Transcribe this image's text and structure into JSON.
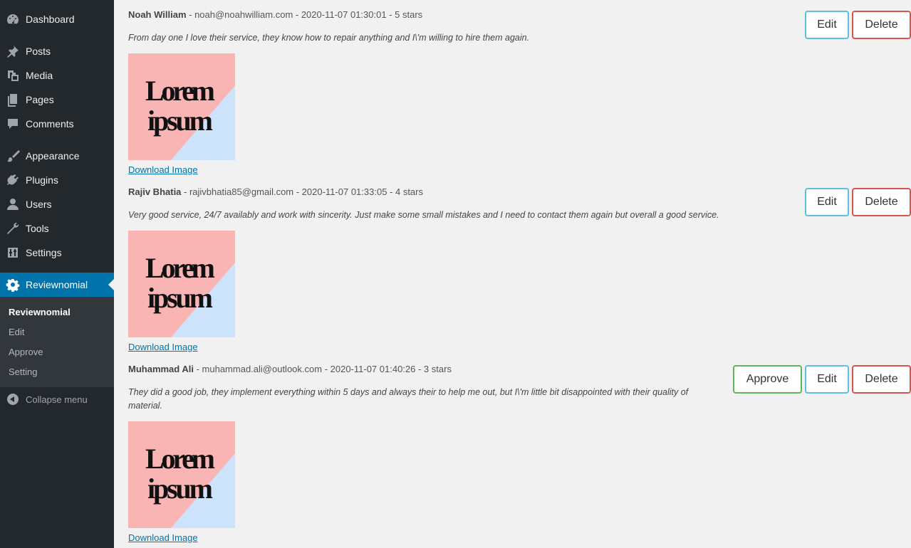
{
  "sidebar": {
    "items": [
      {
        "label": "Dashboard",
        "icon": "dashboard-icon"
      },
      {
        "label": "Posts",
        "icon": "pin-icon"
      },
      {
        "label": "Media",
        "icon": "media-icon"
      },
      {
        "label": "Pages",
        "icon": "pages-icon"
      },
      {
        "label": "Comments",
        "icon": "comment-icon"
      },
      {
        "label": "Appearance",
        "icon": "brush-icon"
      },
      {
        "label": "Plugins",
        "icon": "plugin-icon"
      },
      {
        "label": "Users",
        "icon": "user-icon"
      },
      {
        "label": "Tools",
        "icon": "wrench-icon"
      },
      {
        "label": "Settings",
        "icon": "settings-sliders-icon"
      },
      {
        "label": "Reviewnomial",
        "icon": "gear-icon"
      }
    ],
    "submenu": [
      "Reviewnomial",
      "Edit",
      "Approve",
      "Setting"
    ],
    "collapse_label": "Collapse menu"
  },
  "image_text": {
    "line1": "Lorem",
    "line2": "ipsum"
  },
  "colors": {
    "accent": "#0073aa",
    "edit": "#5bc0de",
    "delete": "#d9534f",
    "approve": "#5cb85c"
  },
  "reviews": [
    {
      "name": "Noah William",
      "meta": " - noah@noahwilliam.com - 2020-11-07 01:30:01 - 5 stars",
      "text": "From day one I love their service, they know how to repair anything and I\\'m willing to hire them again.",
      "download": "Download Image",
      "edit": "Edit",
      "delete": "Delete"
    },
    {
      "name": "Rajiv Bhatia",
      "meta": " - rajivbhatia85@gmail.com - 2020-11-07 01:33:05 - 4 stars",
      "text": "Very good service, 24/7 availably and work with sincerity. Just make some small mistakes and I need to contact them again but overall a good service.",
      "download": "Download Image",
      "edit": "Edit",
      "delete": "Delete"
    },
    {
      "name": "Muhammad Ali",
      "meta": " - muhammad.ali@outlook.com - 2020-11-07 01:40:26 - 3 stars",
      "text": "They did a good job, they implement everything within 5 days and always their to help me out, but I\\'m little bit disappointed with their quality of material.",
      "download": "Download Image",
      "approve": "Approve",
      "edit": "Edit",
      "delete": "Delete"
    }
  ]
}
